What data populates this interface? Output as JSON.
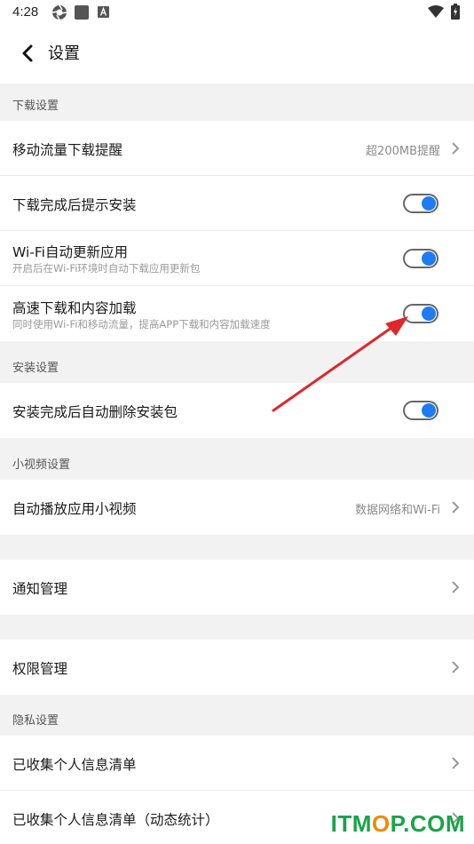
{
  "status_bar": {
    "time": "4:28"
  },
  "header": {
    "title": "设置"
  },
  "sections": {
    "download": "下载设置",
    "install": "安装设置",
    "video": "小视频设置",
    "privacy": "隐私设置"
  },
  "rows": {
    "mobile_data": {
      "title": "移动流量下载提醒",
      "value": "超200MB提醒"
    },
    "prompt_install": {
      "title": "下载完成后提示安装",
      "toggle_on": true
    },
    "wifi_update": {
      "title": "Wi-Fi自动更新应用",
      "subtitle": "开启后在Wi-Fi环境时自动下载应用更新包",
      "toggle_on": true
    },
    "high_speed": {
      "title": "高速下载和内容加载",
      "subtitle": "同时使用Wi-Fi和移动流量，提高APP下载和内容加载速度",
      "toggle_on": true
    },
    "auto_delete": {
      "title": "安装完成后自动删除安装包",
      "toggle_on": true
    },
    "autoplay": {
      "title": "自动播放应用小视频",
      "value": "数据网络和Wi-Fi"
    },
    "notifications": {
      "title": "通知管理"
    },
    "permissions": {
      "title": "权限管理"
    },
    "personal_info": {
      "title": "已收集个人信息清单"
    },
    "personal_info_dynamic": {
      "title": "已收集个人信息清单（动态统计）"
    }
  },
  "watermark": {
    "text_it": "ITM",
    "text_o": "O",
    "text_rest": "P.COM",
    "color_green": "#1aa34a",
    "color_orange": "#f08a00"
  },
  "colors": {
    "toggle_knob": "#1e7cf2",
    "annotation_arrow": "#e0262b"
  }
}
